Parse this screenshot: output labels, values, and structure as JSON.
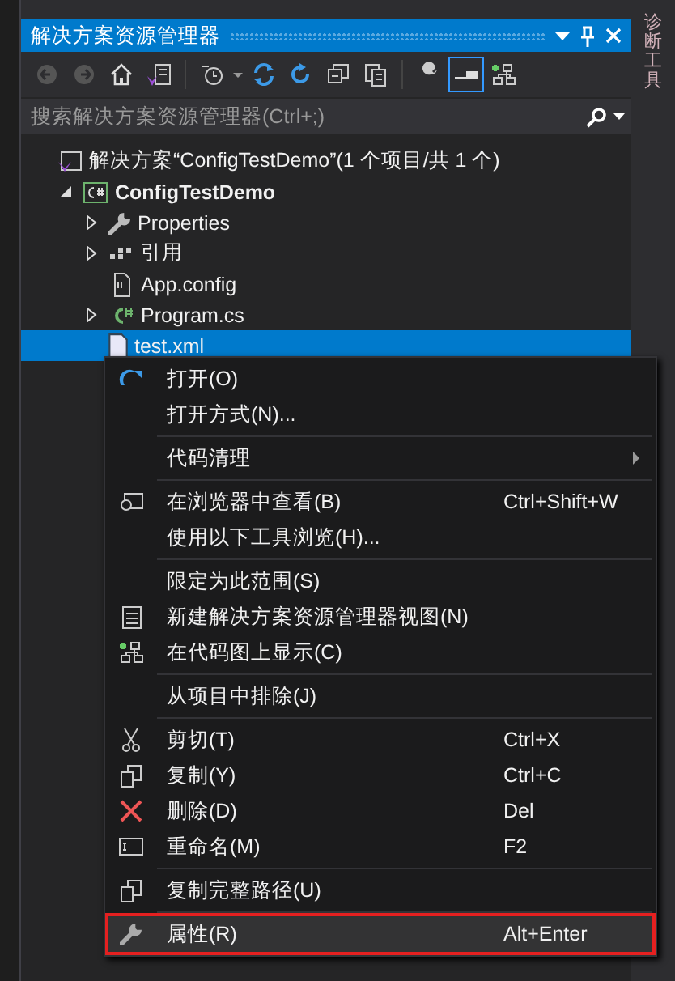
{
  "side_tab": {
    "label": "诊断工具"
  },
  "panel": {
    "title": "解决方案资源管理器"
  },
  "search": {
    "placeholder": "搜索解决方案资源管理器(Ctrl+;)"
  },
  "tree": [
    {
      "kind": "leaf",
      "label": "解决方案“ConfigTestDemo”(1 个项目/共 1 个)",
      "selected": false,
      "children": [
        {
          "kind": "folder",
          "label": "ConfigTestDemo",
          "expanded": true,
          "selected": false,
          "children": [
            {
              "kind": "folder",
              "label": "Properties",
              "expanded": false,
              "selected": false
            },
            {
              "kind": "folder",
              "label": "引用",
              "expanded": false,
              "selected": false
            },
            {
              "kind": "leaf",
              "label": "App.config",
              "selected": false
            },
            {
              "kind": "folder",
              "label": "Program.cs",
              "expanded": false,
              "selected": false
            },
            {
              "kind": "leaf",
              "label": "test.xml",
              "selected": true
            }
          ]
        }
      ]
    }
  ],
  "context_menu": [
    {
      "kind": "item",
      "label": "打开(O)",
      "highlighted": false,
      "annotated": false
    },
    {
      "kind": "item",
      "label": "打开方式(N)...",
      "highlighted": false,
      "annotated": false
    },
    {
      "kind": "separator"
    },
    {
      "kind": "submenu",
      "label": "代码清理",
      "highlighted": false,
      "annotated": false
    },
    {
      "kind": "separator"
    },
    {
      "kind": "item",
      "label": "在浏览器中查看(B)",
      "shortcut": "Ctrl+Shift+W",
      "highlighted": false,
      "annotated": false
    },
    {
      "kind": "item",
      "label": "使用以下工具浏览(H)...",
      "highlighted": false,
      "annotated": false
    },
    {
      "kind": "separator"
    },
    {
      "kind": "item",
      "label": "限定为此范围(S)",
      "highlighted": false,
      "annotated": false
    },
    {
      "kind": "item",
      "label": "新建解决方案资源管理器视图(N)",
      "highlighted": false,
      "annotated": false
    },
    {
      "kind": "item",
      "label": "在代码图上显示(C)",
      "highlighted": false,
      "annotated": false
    },
    {
      "kind": "separator"
    },
    {
      "kind": "item",
      "label": "从项目中排除(J)",
      "highlighted": false,
      "annotated": false
    },
    {
      "kind": "separator"
    },
    {
      "kind": "item",
      "label": "剪切(T)",
      "shortcut": "Ctrl+X",
      "highlighted": false,
      "annotated": false
    },
    {
      "kind": "item",
      "label": "复制(Y)",
      "shortcut": "Ctrl+C",
      "highlighted": false,
      "annotated": false
    },
    {
      "kind": "item",
      "label": "删除(D)",
      "shortcut": "Del",
      "highlighted": false,
      "annotated": false
    },
    {
      "kind": "item",
      "label": "重命名(M)",
      "shortcut": "F2",
      "highlighted": false,
      "annotated": false
    },
    {
      "kind": "separator"
    },
    {
      "kind": "item",
      "label": "复制完整路径(U)",
      "highlighted": false,
      "annotated": false
    },
    {
      "kind": "separator"
    },
    {
      "kind": "item",
      "label": "属性(R)",
      "shortcut": "Alt+Enter",
      "highlighted": true,
      "annotated": true
    }
  ]
}
